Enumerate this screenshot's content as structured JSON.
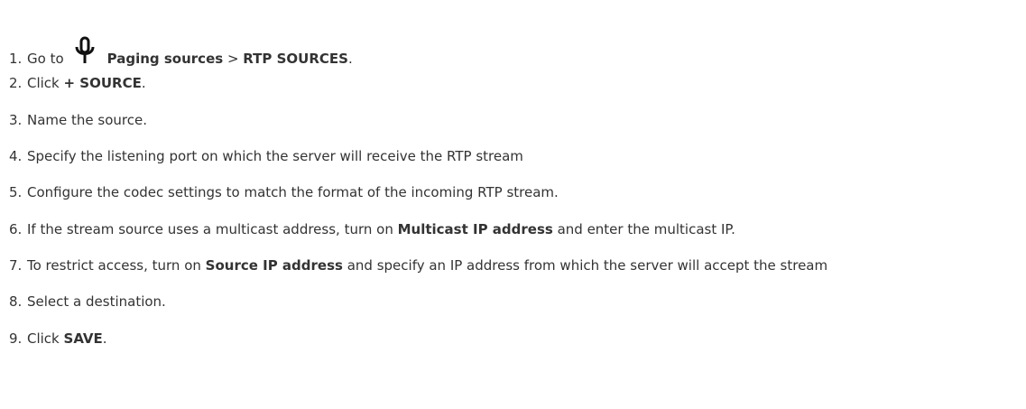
{
  "steps": [
    {
      "number": "1.",
      "parts": {
        "t1": "Go to",
        "icon": "microphone-icon",
        "b1": "Paging sources",
        "t2": " > ",
        "b2": "RTP SOURCES",
        "t3": "."
      }
    },
    {
      "number": "2.",
      "parts": {
        "t1": "Click ",
        "b1": "+ SOURCE",
        "t2": "."
      }
    },
    {
      "number": "3.",
      "parts": {
        "t1": "Name the source."
      }
    },
    {
      "number": "4.",
      "parts": {
        "t1": "Specify the listening port on which the server will receive the RTP stream"
      }
    },
    {
      "number": "5.",
      "parts": {
        "t1": "Configure the codec settings to match the format of the incoming RTP stream."
      }
    },
    {
      "number": "6.",
      "parts": {
        "t1": "If the stream source uses a multicast address, turn on ",
        "b1": "Multicast IP address",
        "t2": " and enter the multicast IP."
      }
    },
    {
      "number": "7.",
      "parts": {
        "t1": "To restrict access, turn on ",
        "b1": "Source IP address",
        "t2": " and specify an IP address from which the server will accept the stream"
      }
    },
    {
      "number": "8.",
      "parts": {
        "t1": "Select a destination."
      }
    },
    {
      "number": "9.",
      "parts": {
        "t1": "Click ",
        "b1": "SAVE",
        "t2": "."
      }
    }
  ]
}
